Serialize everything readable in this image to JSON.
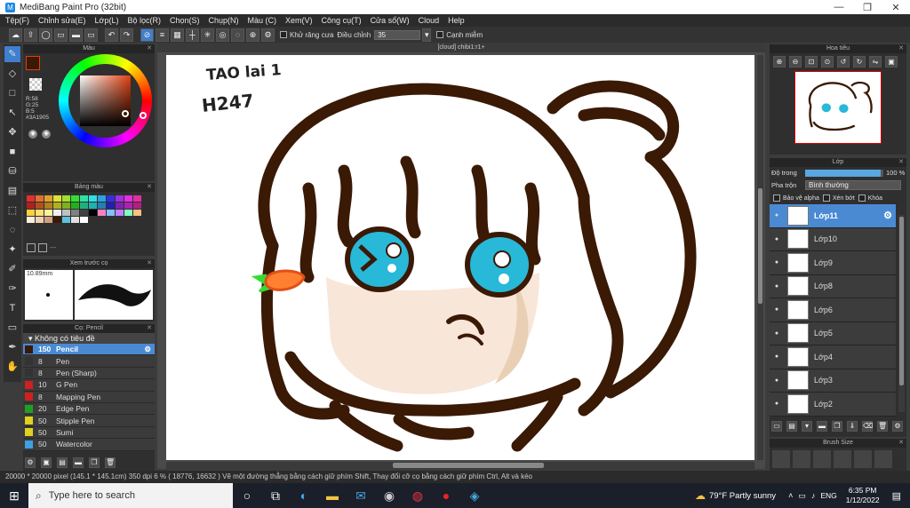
{
  "window": {
    "title": "MediBang Paint Pro (32bit)"
  },
  "menu": [
    "Tệp(F)",
    "Chỉnh sửa(E)",
    "Lớp(L)",
    "Bộ lọc(R)",
    "Chọn(S)",
    "Chụp(N)",
    "Màu (C)",
    "Xem(V)",
    "Công cụ(T)",
    "Cửa sổ(W)",
    "Cloud",
    "Help"
  ],
  "toolbar": {
    "antialias_label": "Khử răng cưa",
    "adjust_label": "Điều chỉnh",
    "adjust_value": "35",
    "snap_label": "Cạnh miễm"
  },
  "color_panel": {
    "title": "Màu",
    "r": "R:58",
    "g": "G:25",
    "b": "B:5",
    "hex": "#3A1905",
    "fg": "#3a1905",
    "accent": "#e04010"
  },
  "palette_panel": {
    "title": "Bảng màu",
    "ellipsis": "---"
  },
  "preview_panel": {
    "title": "Xem trước cọ",
    "size": "10.89mm"
  },
  "brush_panel": {
    "title": "Cọ: Pencil",
    "group": "Không có tiêu đề",
    "items": [
      {
        "size": "150",
        "name": "Pencil",
        "color": "#3a1905"
      },
      {
        "size": "8",
        "name": "Pen",
        "color": "#333333"
      },
      {
        "size": "8",
        "name": "Pen (Sharp)",
        "color": "#333333"
      },
      {
        "size": "10",
        "name": "G Pen",
        "color": "#d02020"
      },
      {
        "size": "8",
        "name": "Mapping Pen",
        "color": "#d02020"
      },
      {
        "size": "20",
        "name": "Edge Pen",
        "color": "#20a020"
      },
      {
        "size": "50",
        "name": "Stipple Pen",
        "color": "#e0d020"
      },
      {
        "size": "50",
        "name": "Sumi",
        "color": "#e0d020"
      },
      {
        "size": "50",
        "name": "Watercolor",
        "color": "#40a0e0"
      }
    ]
  },
  "canvas": {
    "tab": "[cloud] chibi1:r1+",
    "handwriting_line1": "TAO lai 1",
    "handwriting_line2": "H247"
  },
  "navigator": {
    "title": "Hoa tiêu"
  },
  "layer_panel": {
    "title": "Lớp",
    "opacity_label": "Độ trong",
    "opacity_value": "100 %",
    "blend_label": "Pha trộn",
    "blend_value": "Bình thường",
    "protect_alpha": "Bảo vệ alpha",
    "clipping": "Xén bớt",
    "lock": "Khóa",
    "layers": [
      "Lớp11",
      "Lớp10",
      "Lớp9",
      "Lớp8",
      "Lớp6",
      "Lớp5",
      "Lớp4",
      "Lớp3",
      "Lớp2"
    ],
    "opacity_fraction": 0.97
  },
  "brushsize_panel": {
    "title": "Brush Size"
  },
  "status": {
    "text": "20000 * 20000 pixel    (145.1 * 145.1cm)   350 dpi    6 %    ( 18776, 16632 )    Vẽ một đường thẳng bằng cách giữ phím Shift, Thay đổi cỡ cọ bằng cách giữ phím Ctrl, Alt và kéo"
  },
  "taskbar": {
    "search_placeholder": "Type here to search",
    "weather": "79°F  Partly sunny",
    "lang": "ENG",
    "time": "6:35 PM",
    "date": "1/12/2022"
  }
}
